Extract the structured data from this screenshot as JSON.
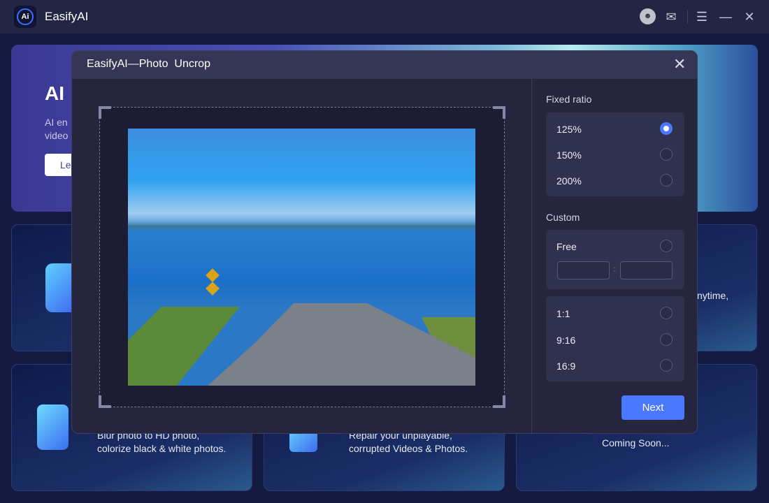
{
  "app": {
    "title": "EasifyAI",
    "logo_text": "Ai"
  },
  "titlebar": {
    "icons": [
      "robot-icon",
      "mail-icon",
      "menu-icon",
      "minimize-icon",
      "close-icon"
    ]
  },
  "background": {
    "banner": {
      "title": "AI",
      "desc_line1": "AI en",
      "desc_line2": "video",
      "button": "Le"
    },
    "cards": [
      {
        "text": "nytime,"
      },
      {
        "line1": "Blur photo to HD photo,",
        "line2": "colorize black & white photos."
      },
      {
        "line1": "Repair your unplayable,",
        "line2": "corrupted Videos & Photos."
      },
      {
        "text": "Coming Soon..."
      }
    ]
  },
  "dialog": {
    "title": "EasifyAI—Photo  Uncrop",
    "fixed_ratio": {
      "label": "Fixed ratio",
      "options": [
        {
          "label": "125%",
          "selected": true
        },
        {
          "label": "150%",
          "selected": false
        },
        {
          "label": "200%",
          "selected": false
        }
      ]
    },
    "custom": {
      "label": "Custom",
      "free": {
        "label": "Free",
        "selected": false,
        "width": "",
        "height": "",
        "separator": ":"
      },
      "options": [
        {
          "label": "1:1",
          "selected": false
        },
        {
          "label": "9:16",
          "selected": false
        },
        {
          "label": "16:9",
          "selected": false
        }
      ]
    },
    "next_label": "Next",
    "accent": "#4a78ff"
  }
}
